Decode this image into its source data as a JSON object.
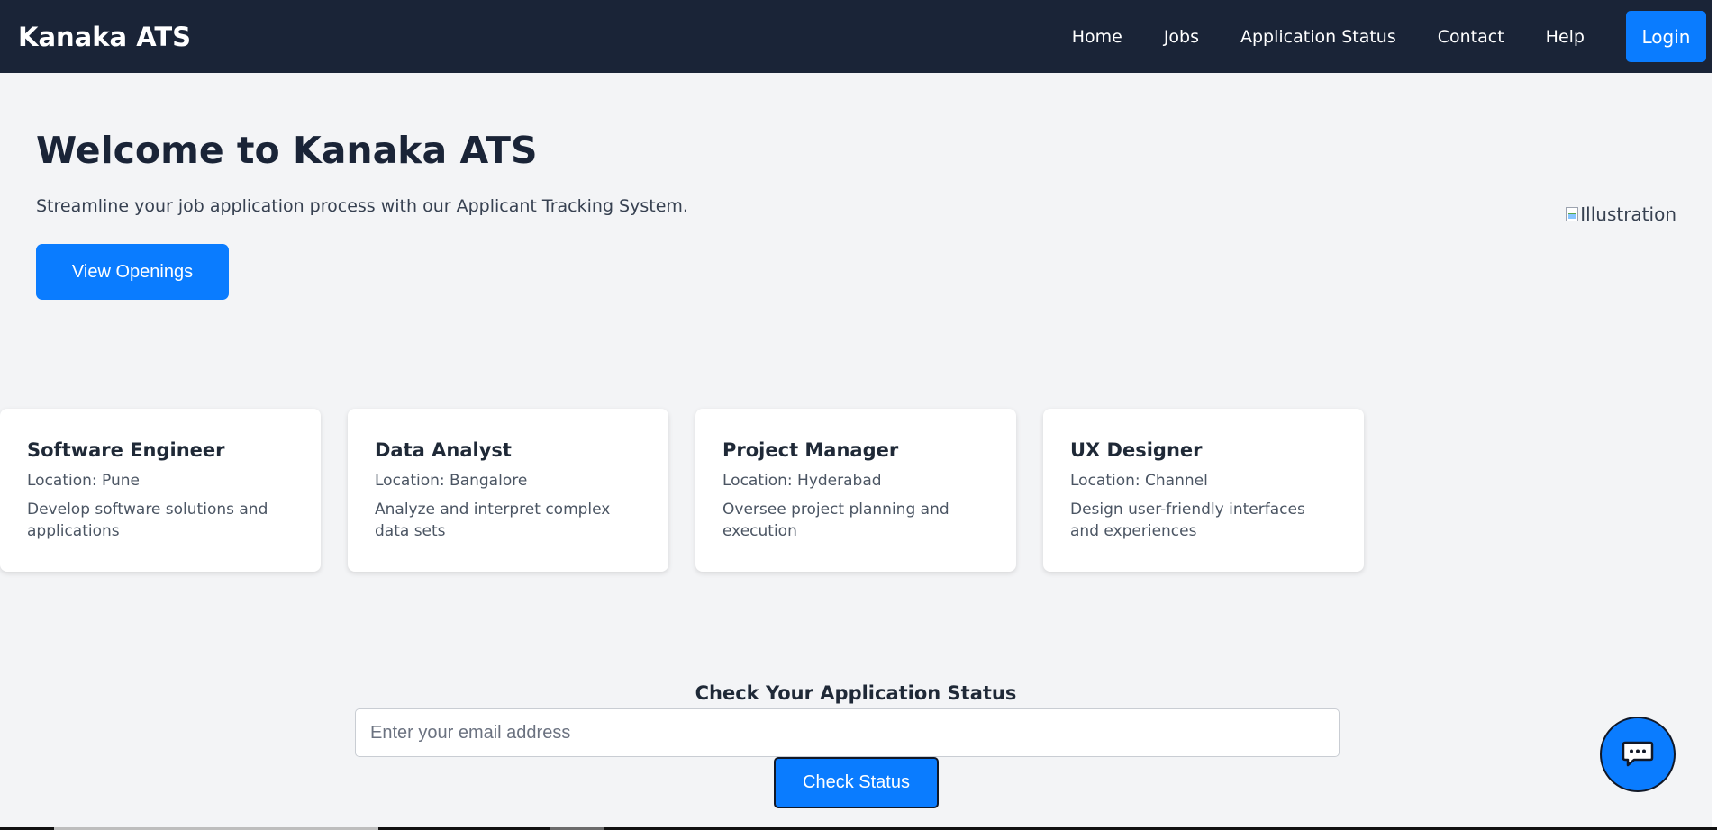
{
  "navbar": {
    "brand": "Kanaka ATS",
    "links": [
      "Home",
      "Jobs",
      "Application Status",
      "Contact",
      "Help"
    ],
    "login_label": "Login"
  },
  "hero": {
    "title": "Welcome to Kanaka ATS",
    "subtitle": "Streamline your job application process with our Applicant Tracking System.",
    "button_label": "View Openings",
    "illustration_alt": "Illustration"
  },
  "jobs": [
    {
      "title": "Software Engineer",
      "location": "Location: Pune",
      "description": "Develop software solutions and applications"
    },
    {
      "title": "Data Analyst",
      "location": "Location: Bangalore",
      "description": "Analyze and interpret complex data sets"
    },
    {
      "title": "Project Manager",
      "location": "Location: Hyderabad",
      "description": "Oversee project planning and execution"
    },
    {
      "title": "UX Designer",
      "location": "Location: Channel",
      "description": "Design user-friendly interfaces and experiences"
    }
  ],
  "status": {
    "title": "Check Your Application Status",
    "input_placeholder": "Enter your email address",
    "button_label": "Check Status"
  },
  "chat": {
    "icon": "chat-bubble-icon"
  },
  "colors": {
    "navbar": "#1a2437",
    "accent": "#0a7cff",
    "background": "#f3f4f6"
  }
}
